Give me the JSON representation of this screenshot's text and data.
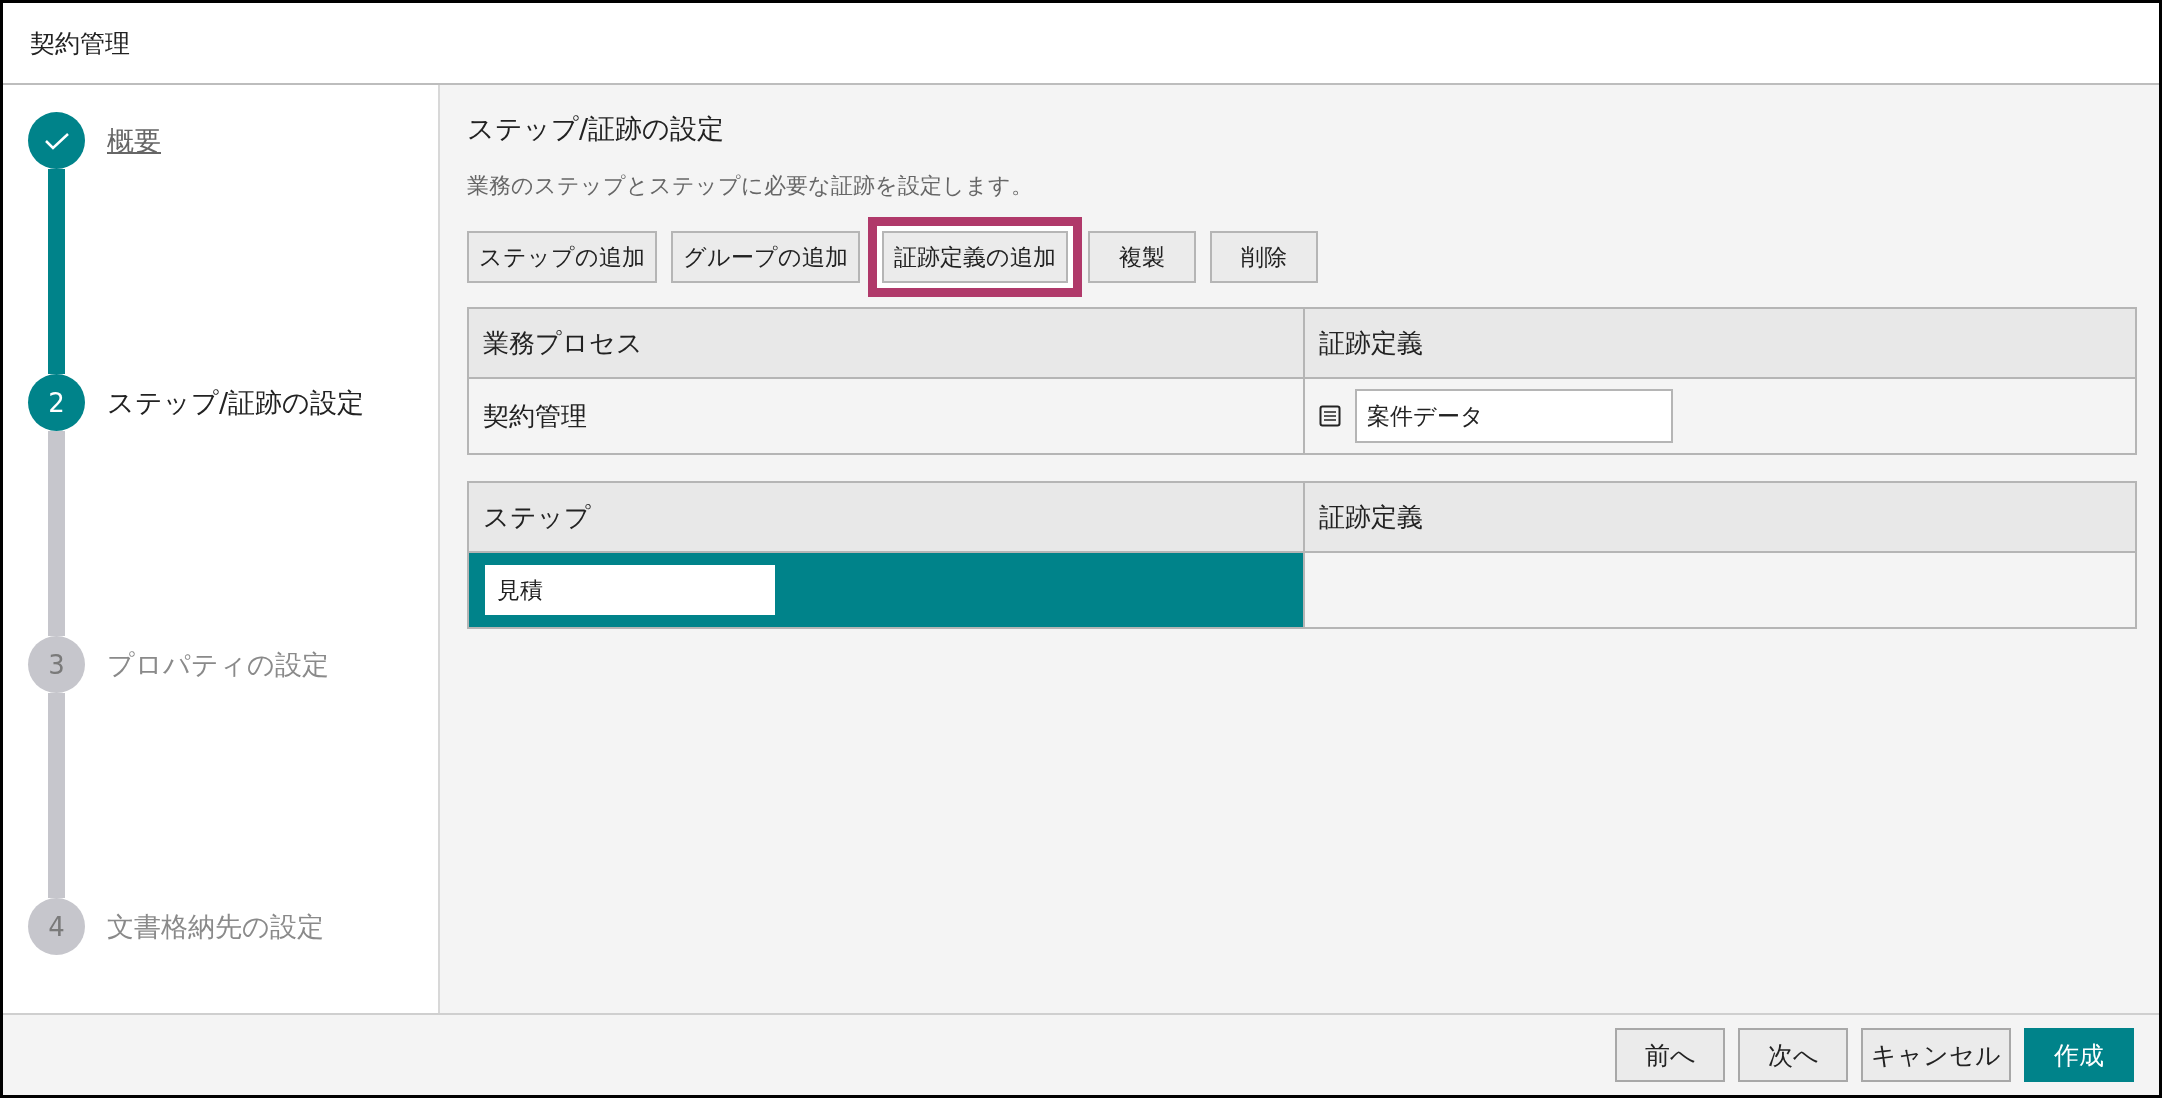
{
  "window": {
    "title": "契約管理"
  },
  "steps": [
    {
      "label": "概要",
      "done": true,
      "current": false
    },
    {
      "number": "2",
      "label": "ステップ/証跡の設定",
      "done": false,
      "current": true
    },
    {
      "number": "3",
      "label": "プロパティの設定",
      "done": false,
      "current": false
    },
    {
      "number": "4",
      "label": "文書格納先の設定",
      "done": false,
      "current": false
    }
  ],
  "heading": "ステップ/証跡の設定",
  "description": "業務のステップとステップに必要な証跡を設定します。",
  "toolbar": [
    {
      "label": "ステップの追加",
      "highlighted": false
    },
    {
      "label": "グループの追加",
      "highlighted": false
    },
    {
      "label": "証跡定義の追加",
      "highlighted": true
    },
    {
      "label": "複製",
      "highlighted": false
    },
    {
      "label": "削除",
      "highlighted": false
    }
  ],
  "process_table": {
    "columns": [
      "業務プロセス",
      "証跡定義"
    ],
    "rows": [
      {
        "process": "契約管理",
        "evidence": "案件データ"
      }
    ]
  },
  "step_table": {
    "columns": [
      "ステップ",
      "証跡定義"
    ],
    "rows": [
      {
        "step": "見積",
        "selected": true
      }
    ]
  },
  "footer_buttons": [
    {
      "label": "前へ",
      "kind": "secondary"
    },
    {
      "label": "次へ",
      "kind": "secondary"
    },
    {
      "label": "キャンセル",
      "kind": "secondary"
    },
    {
      "label": "作成",
      "kind": "primary"
    }
  ]
}
